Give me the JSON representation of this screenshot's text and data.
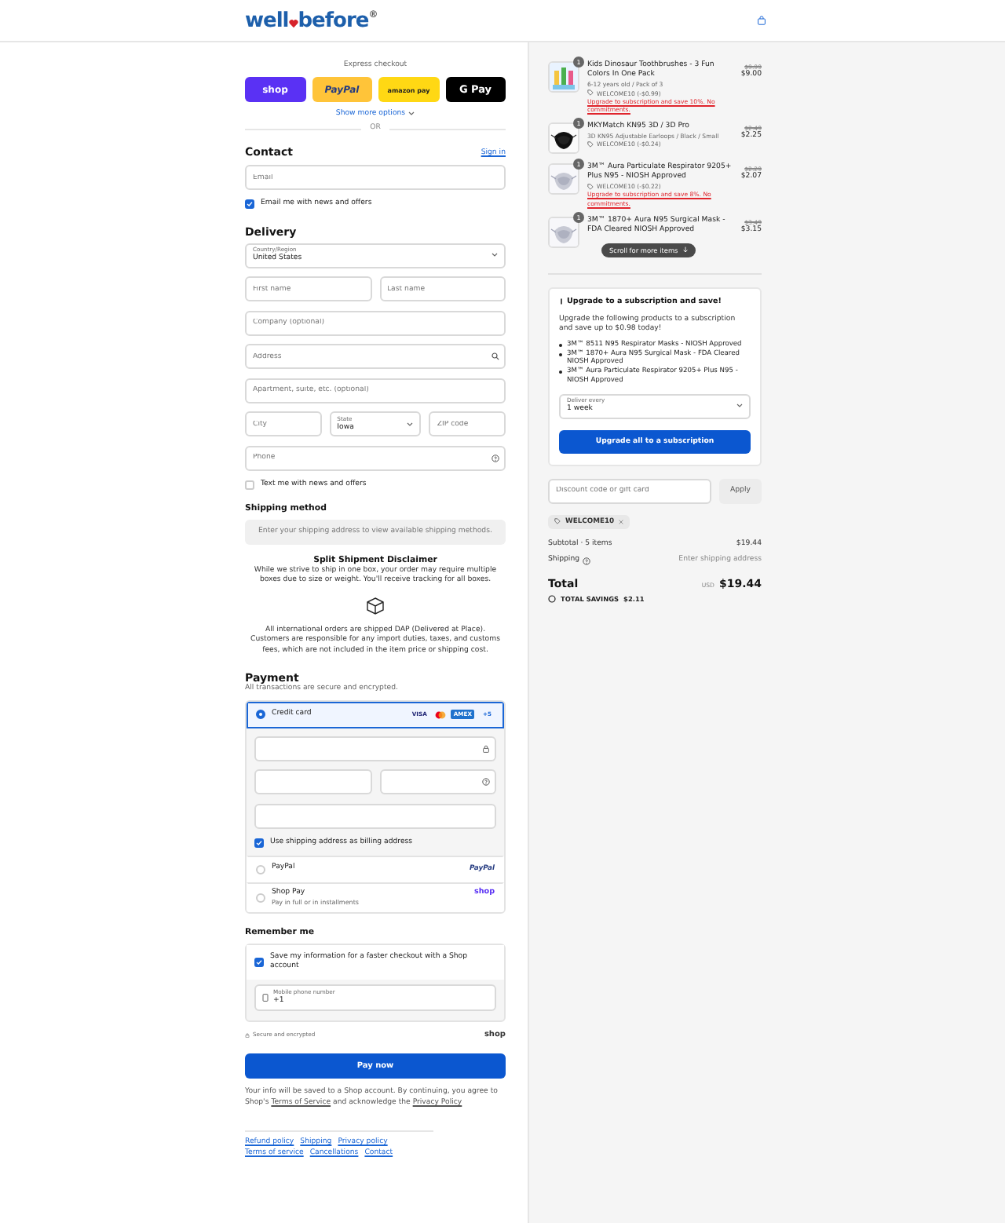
{
  "header": {
    "logo": {
      "left": "well",
      "right": "before",
      "mark": "®"
    }
  },
  "express": {
    "title": "Express checkout",
    "buttons": [
      {
        "kind": "shop",
        "label": "shop"
      },
      {
        "kind": "paypal",
        "label": "PayPal"
      },
      {
        "kind": "amazon",
        "label": "amazon pay"
      },
      {
        "kind": "gpay",
        "label": "G Pay"
      }
    ],
    "more": "Show more options",
    "divider": "OR"
  },
  "contact": {
    "title": "Contact",
    "link": "Sign in",
    "email": {
      "placeholder": "Email"
    },
    "news": {
      "label": "Email me with news and offers",
      "checked": true
    }
  },
  "delivery": {
    "title": "Delivery",
    "rows": [
      [
        {
          "kind": "select",
          "label": "Country/Region",
          "value": "United States"
        }
      ],
      [
        {
          "kind": "text",
          "placeholder": "First name"
        },
        {
          "kind": "text",
          "placeholder": "Last name"
        }
      ],
      [
        {
          "kind": "text",
          "placeholder": "Company (optional)"
        }
      ],
      [
        {
          "kind": "search",
          "placeholder": "Address"
        }
      ],
      [
        {
          "kind": "text",
          "placeholder": "Apartment, suite, etc. (optional)"
        }
      ],
      [
        {
          "kind": "text",
          "placeholder": "City"
        },
        {
          "kind": "select",
          "label": "State",
          "value": "Iowa"
        },
        {
          "kind": "text",
          "placeholder": "ZIP code"
        }
      ],
      [
        {
          "kind": "help",
          "placeholder": "Phone"
        }
      ]
    ],
    "sms": {
      "label": "Text me with news and offers",
      "checked": false
    }
  },
  "shipping": {
    "title": "Shipping method",
    "notice": "Enter your shipping address to view available shipping methods.",
    "disclaimer_title": "Split Shipment Disclaimer",
    "disclaimer": "While we strive to ship in one box, your order may require multiple boxes due to size or weight. You'll receive tracking for all boxes.",
    "international": "All international orders are shipped DAP (Delivered at Place). Customers are responsible for any import duties, taxes, and customs fees, which are not included in the item price or shipping cost."
  },
  "payment": {
    "title": "Payment",
    "subtitle": "All transactions are secure and encrypted.",
    "methods": [
      {
        "kind": "card",
        "label": "Credit card",
        "selected": true,
        "badges": [
          {
            "kind": "text",
            "label": "VISA"
          },
          {
            "kind": "mastercard"
          },
          {
            "kind": "amex",
            "label": "AMEX"
          },
          {
            "kind": "text",
            "label": "+5"
          }
        ]
      },
      {
        "kind": "paypal",
        "label": "PayPal",
        "selected": false,
        "logo": "PayPal"
      },
      {
        "kind": "shoppay",
        "label": "Shop Pay",
        "selected": false,
        "sub": "Pay in full or in installments",
        "logo": "shop"
      }
    ],
    "billing": {
      "label": "Use shipping address as billing address",
      "checked": true
    }
  },
  "remember": {
    "title": "Remember me",
    "save": {
      "label": "Save my information for a faster checkout with a Shop account",
      "checked": true
    },
    "phone": {
      "label": "Mobile phone number",
      "value": "+1"
    },
    "secure": "Secure and encrypted",
    "shop": "shop"
  },
  "pay_button": "Pay now",
  "legal": {
    "before": "Your info will be saved to a Shop account. By continuing, you agree to Shop's",
    "terms": "Terms of Service",
    "middle": "and acknowledge the",
    "privacy": "Privacy Policy"
  },
  "footer_links": [
    "Refund policy",
    "Shipping",
    "Privacy policy",
    "Terms of service",
    "Cancellations",
    "Contact"
  ],
  "cart": {
    "items": [
      {
        "qty": "1",
        "title": "Kids Dinosaur Toothbrushes - 3 Fun Colors In One Pack",
        "variant": "6-12 years old / Pack of 3",
        "discount": "WELCOME10 (-$0.99)",
        "upgrade": "Upgrade to subscription and save 10%. No commitments.",
        "was": "$9.99",
        "price": "$9.00"
      },
      {
        "qty": "1",
        "title": "MKYMatch KN95 3D / 3D Pro",
        "variant": "3D KN95 Adjustable Earloops / Black / Small",
        "discount": "WELCOME10 (-$0.24)",
        "was": "$2.49",
        "price": "$2.25"
      },
      {
        "qty": "1",
        "title": "3M™ Aura Particulate Respirator 9205+ Plus N95 - NIOSH Approved",
        "discount": "WELCOME10 (-$0.22)",
        "upgrade": "Upgrade to subscription and save 8%. No commitments.",
        "was": "$2.29",
        "price": "$2.07"
      },
      {
        "qty": "1",
        "title": "3M™ 1870+ Aura N95 Surgical Mask - FDA Cleared NIOSH Approved",
        "was": "$3.49",
        "price": "$3.15"
      }
    ],
    "scroll_hint": "Scroll for more items",
    "subscription": {
      "title": "Upgrade to a subscription and save!",
      "text": "Upgrade the following products to a subscription and save up to $0.98 today!",
      "products": [
        "3M™ 8511 N95 Respirator Masks - NIOSH Approved",
        "3M™ 1870+ Aura N95 Surgical Mask - FDA Cleared NIOSH Approved",
        "3M™ Aura Particulate Respirator 9205+ Plus N95 - NIOSH Approved"
      ],
      "select": {
        "label": "Deliver every",
        "value": "1 week"
      },
      "button": "Upgrade all to a subscription"
    },
    "discount": {
      "placeholder": "Discount code or gift card",
      "button": "Apply",
      "tag": "WELCOME10"
    },
    "subtotal": {
      "label": "Subtotal · 5 items",
      "value": "$19.44"
    },
    "shipping": {
      "label": "Shipping",
      "value": "Enter shipping address"
    },
    "total": {
      "label": "Total",
      "currency": "USD",
      "value": "$19.44"
    },
    "savings": {
      "label": "TOTAL SAVINGS",
      "value": "$2.11"
    }
  }
}
